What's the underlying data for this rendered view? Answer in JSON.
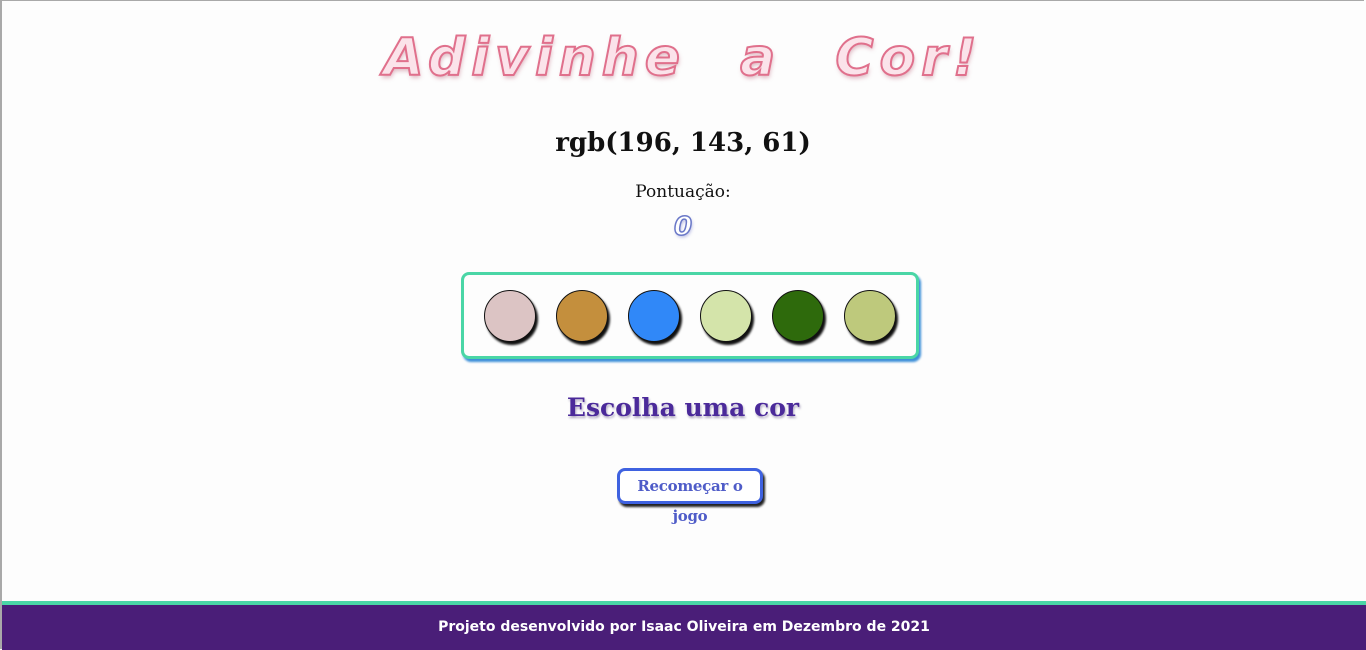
{
  "header": {
    "title": "Adivinhe a Cor!"
  },
  "game": {
    "rgb_text": "rgb(196, 143, 61)",
    "score_label": "Pontuação:",
    "score": "0",
    "balls": [
      {
        "color": "#dcc4c4"
      },
      {
        "color": "#c48f3d"
      },
      {
        "color": "#3088f8"
      },
      {
        "color": "#d4e4aa"
      },
      {
        "color": "#2e6a0c"
      },
      {
        "color": "#bec97c"
      }
    ],
    "answer_text": "Escolha uma cor",
    "reset_label": "Recomeçar o jogo"
  },
  "footer": {
    "text": "Projeto desenvolvido por Isaac Oliveira em Dezembro de 2021"
  },
  "colors": {
    "accent_green": "#4ad6a6",
    "footer_bg": "#4a1e78",
    "title_pink": "#e0708c",
    "answer_purple": "#4b2a9a",
    "button_blue": "#3f62e0"
  }
}
